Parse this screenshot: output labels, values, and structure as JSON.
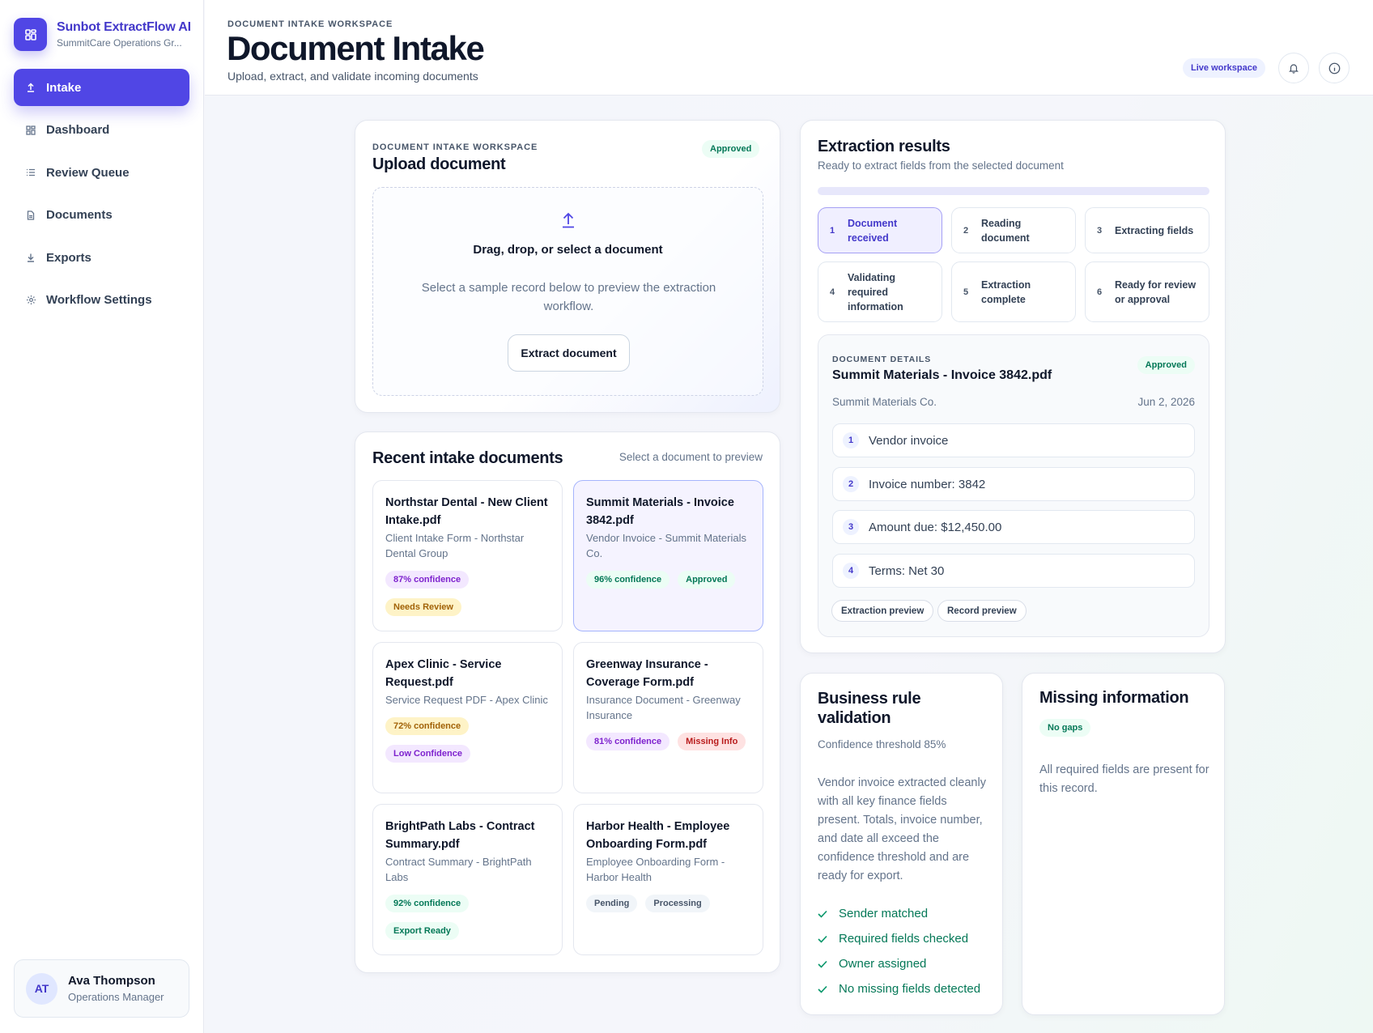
{
  "app": {
    "name": "Sunbot ExtractFlow AI",
    "org": "SummitCare Operations Gr..."
  },
  "nav": [
    {
      "label": "Intake",
      "icon": "upload-icon",
      "active": true
    },
    {
      "label": "Dashboard",
      "icon": "grid-icon",
      "active": false
    },
    {
      "label": "Review Queue",
      "icon": "list-icon",
      "active": false
    },
    {
      "label": "Documents",
      "icon": "document-icon",
      "active": false
    },
    {
      "label": "Exports",
      "icon": "download-icon",
      "active": false
    },
    {
      "label": "Workflow Settings",
      "icon": "gear-icon",
      "active": false
    }
  ],
  "user": {
    "initials": "AT",
    "name": "Ava Thompson",
    "role": "Operations Manager"
  },
  "header": {
    "eyebrow": "DOCUMENT INTAKE WORKSPACE",
    "title": "Document Intake",
    "subtitle": "Upload, extract, and validate incoming documents",
    "live_label": "Live workspace"
  },
  "upload": {
    "eyebrow": "DOCUMENT INTAKE WORKSPACE",
    "title": "Upload document",
    "status": "Approved",
    "drop_title": "Drag, drop, or select a document",
    "drop_sub": "Select a sample record below to preview the extraction workflow.",
    "button": "Extract document"
  },
  "recent": {
    "title": "Recent intake documents",
    "hint": "Select a document to preview",
    "docs": [
      {
        "name": "Northstar Dental - New Client Intake.pdf",
        "meta": "Client Intake Form - Northstar Dental Group",
        "confidence": "87% confidence",
        "status": "Needs Review",
        "selected": false
      },
      {
        "name": "Summit Materials - Invoice 3842.pdf",
        "meta": "Vendor Invoice - Summit Materials Co.",
        "confidence": "96% confidence",
        "status": "Approved",
        "selected": true
      },
      {
        "name": "Apex Clinic - Service Request.pdf",
        "meta": "Service Request PDF - Apex Clinic",
        "confidence": "72% confidence",
        "status": "Low Confidence",
        "selected": false
      },
      {
        "name": "Greenway Insurance - Coverage Form.pdf",
        "meta": "Insurance Document - Greenway Insurance",
        "confidence": "81% confidence",
        "status": "Missing Info",
        "selected": false
      },
      {
        "name": "BrightPath Labs - Contract Summary.pdf",
        "meta": "Contract Summary - BrightPath Labs",
        "confidence": "92% confidence",
        "status": "Export Ready",
        "selected": false
      },
      {
        "name": "Harbor Health - Employee Onboarding Form.pdf",
        "meta": "Employee Onboarding Form - Harbor Health",
        "confidence": "Pending",
        "status": "Processing",
        "selected": false
      }
    ]
  },
  "extraction": {
    "title": "Extraction results",
    "subtitle": "Ready to extract fields from the selected document",
    "steps": [
      {
        "num": "1",
        "label": "Document received",
        "active": true
      },
      {
        "num": "2",
        "label": "Reading document",
        "active": false
      },
      {
        "num": "3",
        "label": "Extracting fields",
        "active": false
      },
      {
        "num": "4",
        "label": "Validating required information",
        "active": false
      },
      {
        "num": "5",
        "label": "Extraction complete",
        "active": false
      },
      {
        "num": "6",
        "label": "Ready for review or approval",
        "active": false
      }
    ],
    "details": {
      "eyebrow": "DOCUMENT DETAILS",
      "name": "Summit Materials - Invoice 3842.pdf",
      "status": "Approved",
      "vendor": "Summit Materials Co.",
      "date": "Jun 2, 2026",
      "fields": [
        {
          "num": "1",
          "text": "Vendor invoice"
        },
        {
          "num": "2",
          "text": "Invoice number: 3842"
        },
        {
          "num": "3",
          "text": "Amount due: $12,450.00"
        },
        {
          "num": "4",
          "text": "Terms: Net 30"
        }
      ],
      "chips": [
        "Extraction preview",
        "Record preview"
      ]
    }
  },
  "rules": {
    "title": "Business rule validation",
    "threshold": "Confidence threshold 85%",
    "summary": "Vendor invoice extracted cleanly with all key finance fields present. Totals, invoice number, and date all exceed the confidence threshold and are ready for export.",
    "checks": [
      "Sender matched",
      "Required fields checked",
      "Owner assigned",
      "No missing fields detected"
    ]
  },
  "missing": {
    "title": "Missing information",
    "badge": "No gaps",
    "text": "All required fields are present for this record."
  },
  "colors": {
    "accent": "#5046e5",
    "success": "#047857",
    "warning": "#a16207",
    "danger": "#b91c1c"
  }
}
